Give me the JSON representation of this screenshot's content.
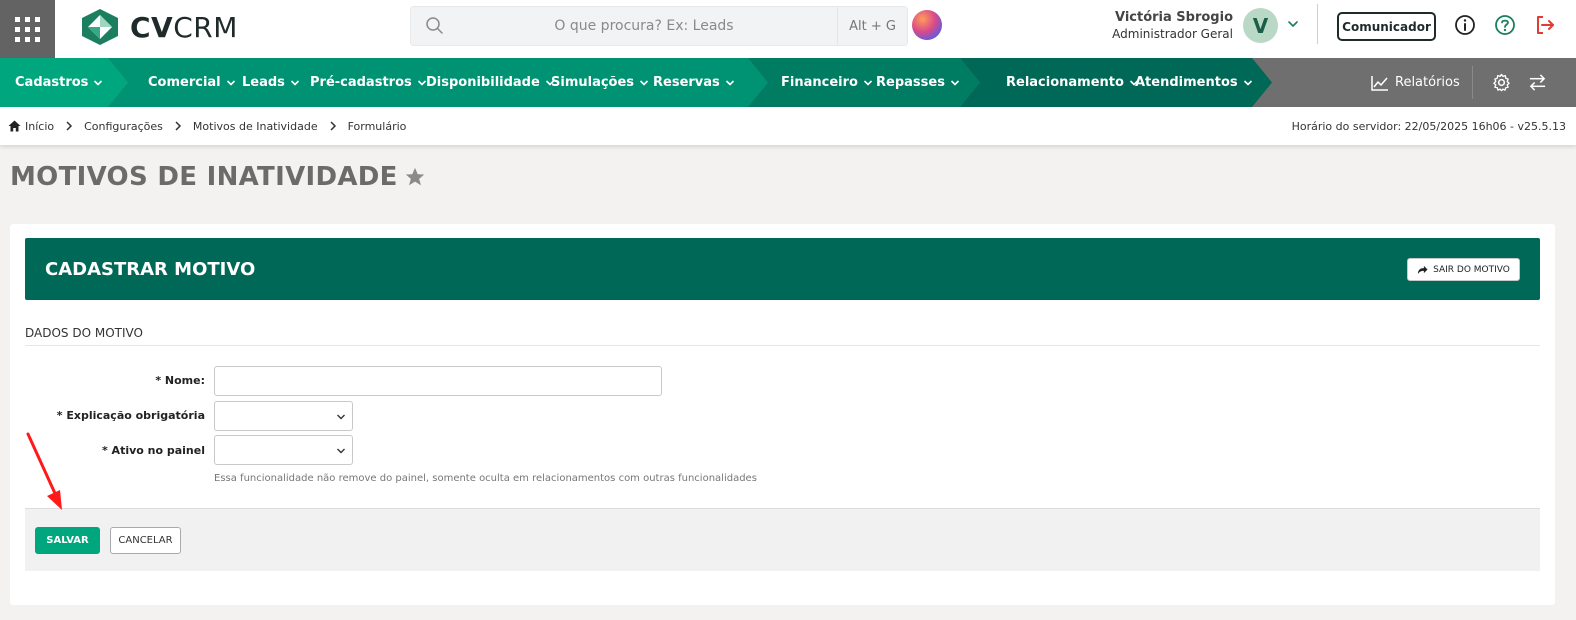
{
  "header": {
    "logo": {
      "bold": "CV",
      "light": "CRM"
    },
    "search": {
      "placeholder": "O que procura? Ex: Leads",
      "shortcut": "Alt + G"
    },
    "user": {
      "name": "Victória Sbrogio",
      "role": "Administrador Geral",
      "initial": "V"
    },
    "comunicador_label": "Comunicador"
  },
  "nav": {
    "groups": [
      {
        "items": [
          "Cadastros"
        ],
        "color": "#00a77e"
      },
      {
        "items": [
          "Comercial",
          "Leads",
          "Pré-cadastros",
          "Disponibilidade",
          "Simulações",
          "Reservas"
        ],
        "color": "#009373"
      },
      {
        "items": [
          "Financeiro",
          "Repasses"
        ],
        "color": "#007c63"
      },
      {
        "items": [
          "Relacionamento",
          "Atendimentos"
        ],
        "color": "#006857"
      }
    ],
    "relatorios": "Relatórios",
    "rest_color": "#6f6f6f"
  },
  "breadcrumb": {
    "items": [
      "Início",
      "Configurações",
      "Motivos de Inatividade",
      "Formulário"
    ],
    "server_time": "Horário do servidor: 22/05/2025 16h06 - v25.5.13"
  },
  "page": {
    "title": "MOTIVOS DE INATIVIDADE"
  },
  "card": {
    "title": "CADASTRAR MOTIVO",
    "exit_label": "SAIR DO MOTIVO",
    "section": "DADOS DO MOTIVO",
    "fields": {
      "nome": {
        "label": "* Nome:",
        "value": ""
      },
      "explicacao": {
        "label": "* Explicação obrigatória",
        "value": ""
      },
      "ativo": {
        "label": "* Ativo no painel",
        "value": ""
      }
    },
    "hint": "Essa funcionalidade não remove do painel, somente oculta em relacionamentos com outras funcionalidades",
    "save_label": "SALVAR",
    "cancel_label": "CANCELAR"
  },
  "colors": {
    "primary": "#00a77e",
    "header_green": "#006857",
    "logout_red": "#e53935",
    "help_green": "#1b7f5f",
    "annotation_arrow": "#ff1a1a"
  },
  "icons": [
    "apps-grid-icon",
    "cvcrm-logo-icon",
    "search-icon",
    "assistant-orb-icon",
    "chevron-down-icon",
    "info-icon",
    "help-icon",
    "logout-icon",
    "chart-icon",
    "gear-icon",
    "swap-icon",
    "home-icon",
    "chevron-right-icon",
    "star-icon",
    "share-icon"
  ]
}
